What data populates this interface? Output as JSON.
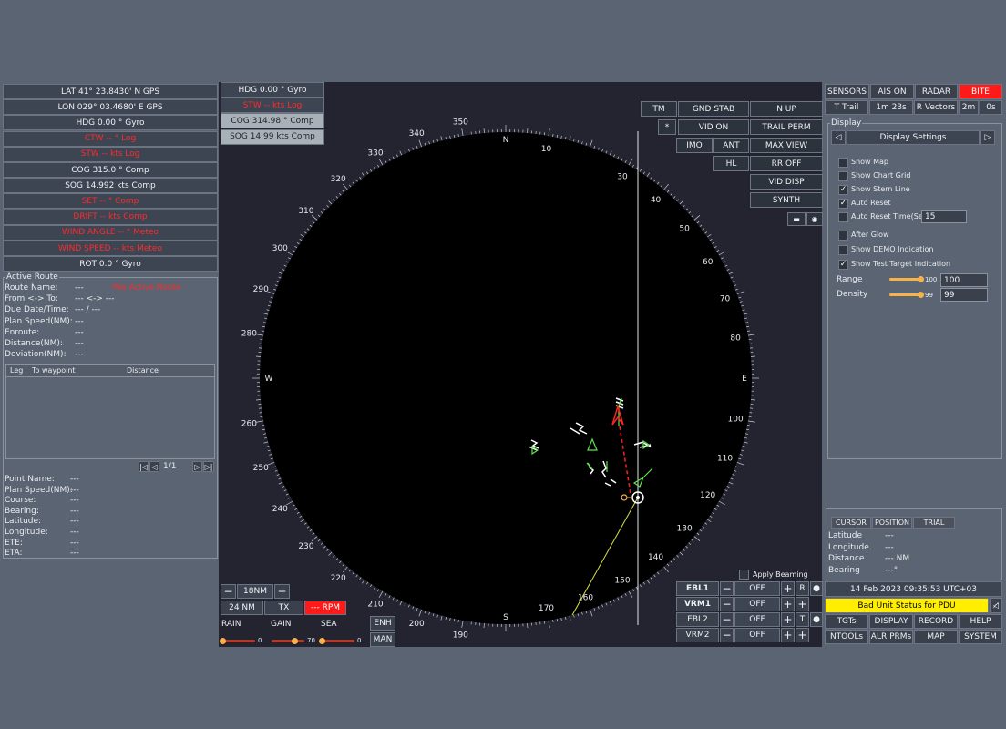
{
  "nav_data": [
    {
      "text": "LAT 41° 23.8430' N  GPS",
      "alert": false
    },
    {
      "text": "LON 029° 03.4680' E  GPS",
      "alert": false
    },
    {
      "text": "HDG  0.00 °   Gyro",
      "alert": false
    },
    {
      "text": "CTW  -- °   Log",
      "alert": true
    },
    {
      "text": "STW  -- kts   Log",
      "alert": true
    },
    {
      "text": "COG  315.0 °   Comp",
      "alert": false
    },
    {
      "text": "SOG  14.992 kts   Comp",
      "alert": false
    },
    {
      "text": "SET  -- °   Comp",
      "alert": true
    },
    {
      "text": "DRIFT  -- kts   Comp",
      "alert": true
    },
    {
      "text": "WIND ANGLE  -- °   Meteo",
      "alert": true
    },
    {
      "text": "WIND SPEED  -- kts  Meteo",
      "alert": true
    },
    {
      "text": "ROT  0.0 °   Gyro",
      "alert": false
    }
  ],
  "route": {
    "legend": "Active Route",
    "no_active": "*No Active Route",
    "fields": [
      {
        "label": "Route Name:",
        "value": "---"
      },
      {
        "label": "From <-> To:",
        "value": "--- <-> ---"
      },
      {
        "label": "Due Date/Time:",
        "value": "---   /   ---"
      },
      {
        "label": "Plan Speed(NM):",
        "value": "---"
      },
      {
        "label": "Enroute:",
        "value": "---"
      },
      {
        "label": "Distance(NM):",
        "value": "---"
      },
      {
        "label": "Deviation(NM):",
        "value": "---"
      }
    ],
    "table_headers": {
      "leg": "Leg",
      "to": "To waypoint",
      "dist": "Distance"
    },
    "page": "1/1",
    "point_fields": [
      {
        "label": "Point Name:",
        "value": "---"
      },
      {
        "label": "Plan Speed(NM):",
        "value": "---"
      },
      {
        "label": "Course:",
        "value": "---"
      },
      {
        "label": "Bearing:",
        "value": "---"
      },
      {
        "label": "Latitude:",
        "value": "---"
      },
      {
        "label": "Longitude:",
        "value": "---"
      },
      {
        "label": "ETE:",
        "value": "---"
      },
      {
        "label": "ETA:",
        "value": "---"
      }
    ]
  },
  "top_info": [
    {
      "text": "HDG  0.00 °        Gyro",
      "alert": false,
      "light": false
    },
    {
      "text": "STW  -- kts        Log",
      "alert": true,
      "light": false
    },
    {
      "text": "COG  314.98 °   Comp",
      "alert": false,
      "light": true
    },
    {
      "text": "SOG  14.99 kts   Comp",
      "alert": false,
      "light": true
    }
  ],
  "radar_buttons": {
    "tm": "TM",
    "gnd_stab": "GND STAB",
    "n_up": "N UP",
    "star": "*",
    "vid_on": "VID ON",
    "trail_perm": "TRAIL PERM",
    "imo": "IMO",
    "ant": "ANT",
    "max_view": "MAX VIEW",
    "hl": "HL",
    "rr_off": "RR OFF",
    "vid_disp": "VID DISP",
    "synth": "SYNTH"
  },
  "compass": {
    "north": "N",
    "south": "S",
    "east": "E",
    "west": "W",
    "labels": [
      "10",
      "30",
      "40",
      "50",
      "60",
      "70",
      "80",
      "100",
      "110",
      "120",
      "130",
      "140",
      "150",
      "160",
      "170",
      "190",
      "200",
      "210",
      "220",
      "230",
      "240",
      "250",
      "260",
      "280",
      "290",
      "300",
      "310",
      "320",
      "330",
      "340",
      "350"
    ]
  },
  "range": {
    "minus": "−",
    "value": "18NM",
    "plus": "+",
    "rings": "24 NM",
    "tx": "TX",
    "rpm": "--- RPM"
  },
  "gain": {
    "rain": "RAIN",
    "gain": "GAIN",
    "sea": "SEA",
    "rain_val": "0",
    "gain_val": "70",
    "sea_val": "0",
    "rain_frac": 0,
    "gain_frac": 0.7,
    "sea_frac": 0,
    "enh": "ENH",
    "man": "MAN"
  },
  "ebl": {
    "apply_beaming": "Apply Beaming",
    "rows": [
      {
        "label": "EBL1",
        "state": "OFF",
        "extra": "R",
        "bold": true
      },
      {
        "label": "VRM1",
        "state": "OFF",
        "extra": "",
        "bold": true
      },
      {
        "label": "EBL2",
        "state": "OFF",
        "extra": "T",
        "bold": false
      },
      {
        "label": "VRM2",
        "state": "OFF",
        "extra": "",
        "bold": false
      }
    ]
  },
  "top_right": {
    "sensors": "SENSORS",
    "ais_on": "AIS ON",
    "radar": "RADAR",
    "bite": "BITE",
    "t_trail": "T Trail",
    "trail_time": "1m 23s",
    "r_vectors": "R Vectors",
    "vec_time": "2m",
    "vec_sec": "0s"
  },
  "display": {
    "legend": "Display",
    "title": "Display Settings",
    "prev": "◁",
    "next": "▷",
    "options": [
      {
        "label": "Show Map",
        "checked": false
      },
      {
        "label": "Show Chart Grid",
        "checked": false
      },
      {
        "label": "Show Stern Line",
        "checked": true
      },
      {
        "label": "Auto Reset",
        "checked": true
      },
      {
        "label": "Auto Reset Time(Sec)",
        "checked": false,
        "input": "15"
      },
      {
        "label": "After Glow",
        "checked": false
      },
      {
        "label": "Show DEMO Indication",
        "checked": false
      },
      {
        "label": "Show Test Target Indication",
        "checked": true
      }
    ],
    "range_label": "Range",
    "range_value": "100",
    "range_input": "100",
    "range_frac": 1,
    "density_label": "Density",
    "density_value": "99",
    "density_input": "99",
    "density_frac": 0.99
  },
  "cursor": {
    "tabs": [
      "CURSOR",
      "POSITION",
      "TRIAL"
    ],
    "fields": [
      {
        "label": "Latitude",
        "value": "---"
      },
      {
        "label": "Longitude",
        "value": "---"
      },
      {
        "label": "Distance",
        "value": "--- NM"
      },
      {
        "label": "Bearing",
        "value": "---°"
      }
    ]
  },
  "status": {
    "datetime": "14 Feb 2023 09:35:53 UTC+03",
    "alarm": "Bad Unit Status for PDU"
  },
  "menu": [
    "TGTs",
    "DISPLAY",
    "RECORD",
    "HELP",
    "NTOOLs",
    "ALR PRMs",
    "MAP",
    "SYSTEM"
  ],
  "colors": {
    "alert": "#ff2a2a",
    "bite": "#ff1a1a",
    "alarm_bg": "#ffee00",
    "radar_bg": "#000000",
    "target": "#64e050"
  }
}
